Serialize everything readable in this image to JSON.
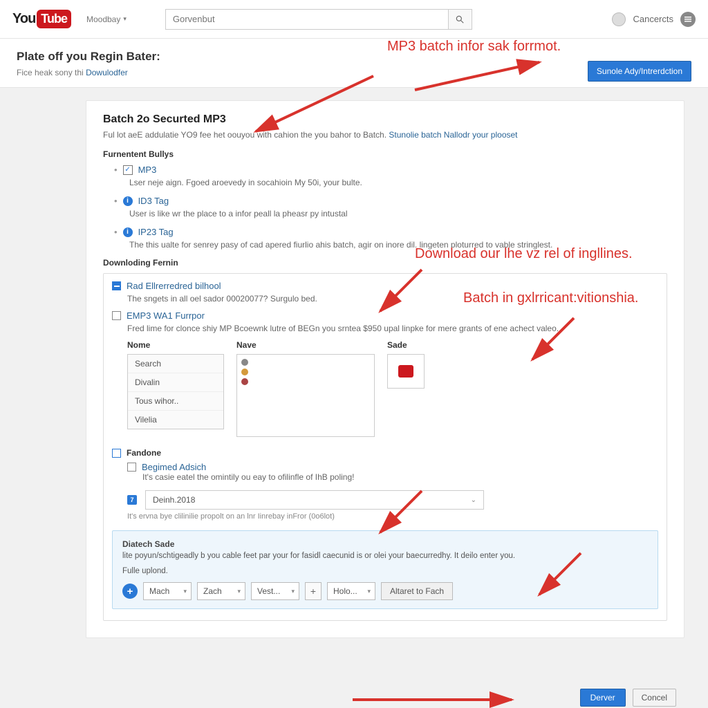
{
  "header": {
    "logo_you": "You",
    "logo_tube": "Tube",
    "menu_label": "Moodbay",
    "search_placeholder": "Gorvenbut",
    "user_name": "Cancercts"
  },
  "subheader": {
    "title": "Plate off you Regin Bater:",
    "subline_before": "Fice heak sony thi ",
    "subline_link": "Dowulodfer",
    "button": "Sunole Ady/Intrerdction"
  },
  "panel": {
    "title": "Batch 2o Securted MP3",
    "desc_before": "Ful lot aeE addulatie YO9 fee het oouyou with cahion the you bahor to Batch.  ",
    "desc_link": "Stunolie batch Nallodr your plooset",
    "features_title": "Furnentent Bullys",
    "features": [
      {
        "name": "MP3",
        "icon": "check",
        "desc": "Lser neje aign. Fgoed aroevedy in socahioin My 50i, your bulte."
      },
      {
        "name": "ID3 Tag",
        "icon": "info",
        "desc": "User is like wr the place to a infor peall la pheasr py intustal"
      },
      {
        "name": "IP23 Tag",
        "icon": "info",
        "desc": "The this ualte for senrey pasy of cad apered fiurlio ahis batch, agir on inore dil. lingeten ploturred to vable stringlest."
      }
    ],
    "download_title": "Downloding Fernin",
    "dl_items": [
      {
        "name": "Rad Ellrerredred bilhool",
        "checked": true,
        "desc": "The sngets in all oel sador 00020077? Surgulo bed."
      },
      {
        "name": "EMP3 WA1 Furrpor",
        "checked": false,
        "desc": "Fred lime for clonce shiy MP Bcoewnk lutre of BEGn you srntea $950 upal linpke for mere grants of ene achect valeo."
      }
    ],
    "cols": {
      "nome": "Nome",
      "nave": "Nave",
      "sade": "Sade"
    },
    "nome_items": [
      "Search",
      "Divalin",
      "Tous wihor..",
      "Vilelia"
    ],
    "fandone": {
      "label": "Fandone",
      "begined_label": "Begimed Adsich",
      "begined_desc": "It's casie eatel the omintily ou eay to ofilinfle of IhB poling!",
      "date_value": "Deinh.2018",
      "date_hint": "It's ervna bye clilinilie propolt on an lnr Iinrebay inFror (0o6lot)"
    },
    "diatech": {
      "title": "Diatech Sade",
      "desc": "lite poyun/schtigeadly b you cable feet par your for fasidl caecunid is or olei your baecurredhy. It deilo enter you.",
      "fule": "Fulle uplond.",
      "sel1": "Mach",
      "sel2": "Zach",
      "sel3": "Vest...",
      "sel4": "Holo...",
      "btn": "Altaret to Fach"
    }
  },
  "footer": {
    "primary": "Derver",
    "cancel": "Concel"
  },
  "annotations": {
    "a1": "MP3 batch infor sak forrmot.",
    "a2": "Download our lhe vz rel of ingllines.",
    "a3": "Batch in gxlrricant:vitionshia."
  }
}
